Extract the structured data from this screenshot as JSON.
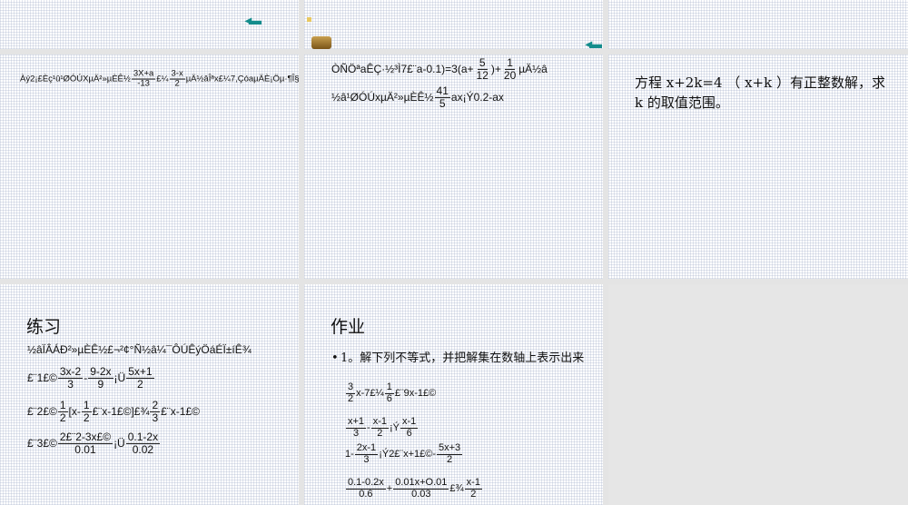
{
  "slides": [
    {
      "id": "s1-top"
    },
    {
      "id": "s2-top"
    },
    {
      "id": "s3-top"
    },
    {
      "id": "s4",
      "lines": [
        [
          "Àý2¡£Èç¹û¹ØÓÚXµÄ²»µÈÊ½",
          {
            "n": "3X+a",
            "d": "-13"
          },
          "£¼",
          {
            "n": "3-x",
            "d": "2"
          },
          "µÄ½âÎªx£¼7,ÇóaµÄÈ¡Öµ·¶Î§."
        ]
      ]
    },
    {
      "id": "s5",
      "lines": [
        [
          "ÒÑÖªaÊÇ·½³Ì7£¨a-0.1)=3(a+",
          {
            "n": "5",
            "d": "12"
          },
          ")+",
          {
            "n": "1",
            "d": "20"
          },
          "µÄ½â"
        ],
        [
          "½â¹ØÓÚxµÄ²»µÈÊ½",
          {
            "n": "41",
            "d": "5"
          },
          "ax¡Ý0.2-ax"
        ]
      ]
    },
    {
      "id": "s6",
      "text": "方程 x+2k=4 （ x+k ）有正整数解，求 k 的取值范围。"
    },
    {
      "id": "s7",
      "title": "练习",
      "lines": [
        [
          "½âÏÂÁÐ²»µÈÊ½£¬²¢°Ñ½â¼¯ÔÚÊýÖáÉÏ±íÊ¾"
        ],
        [
          "£¨1£©",
          {
            "n": "3x-2",
            "d": "3"
          },
          "-",
          {
            "n": "9-2x",
            "d": "9"
          },
          "¡Ü",
          {
            "n": "5x+1",
            "d": "2"
          }
        ],
        [
          "£¨2£©",
          {
            "n": "1",
            "d": "2"
          },
          "[x-",
          {
            "n": "1",
            "d": "2"
          },
          "£¨x-1£©]£¾",
          {
            "n": "2",
            "d": "3"
          },
          "£¨x-1£©"
        ],
        [
          "£¨3£©",
          {
            "n": "2£¨2-3x£©",
            "d": "0.01"
          },
          "¡Ü",
          {
            "n": "0.1-2x",
            "d": "0.02"
          }
        ]
      ]
    },
    {
      "id": "s8",
      "title": "作业",
      "bullet": "1。解下列不等式，并把解集在数轴上表示出来",
      "lines": [
        [
          {
            "n": "3",
            "d": "2"
          },
          "x-7£¼",
          {
            "n": "1",
            "d": "6"
          },
          "£¨9x-1£©"
        ],
        [
          {
            "n": "x+1",
            "d": "3"
          },
          "-",
          {
            "n": "x-1",
            "d": "2"
          },
          "¡Ý",
          {
            "n": "x-1",
            "d": "6"
          }
        ],
        [
          "1-",
          {
            "n": "2x-1",
            "d": "3"
          },
          "¡Ý2£¨x+1£©-",
          {
            "n": "5x+3",
            "d": "2"
          }
        ],
        [
          {
            "n": "0.1-0.2x",
            "d": "0.6"
          },
          "+",
          {
            "n": "0.01x+O.01",
            "d": "0.03"
          },
          "£¾",
          {
            "n": "x-1",
            "d": "2"
          }
        ]
      ]
    }
  ],
  "colors": {
    "arrow": "#138c8c",
    "gap": "#e4e4e4"
  }
}
